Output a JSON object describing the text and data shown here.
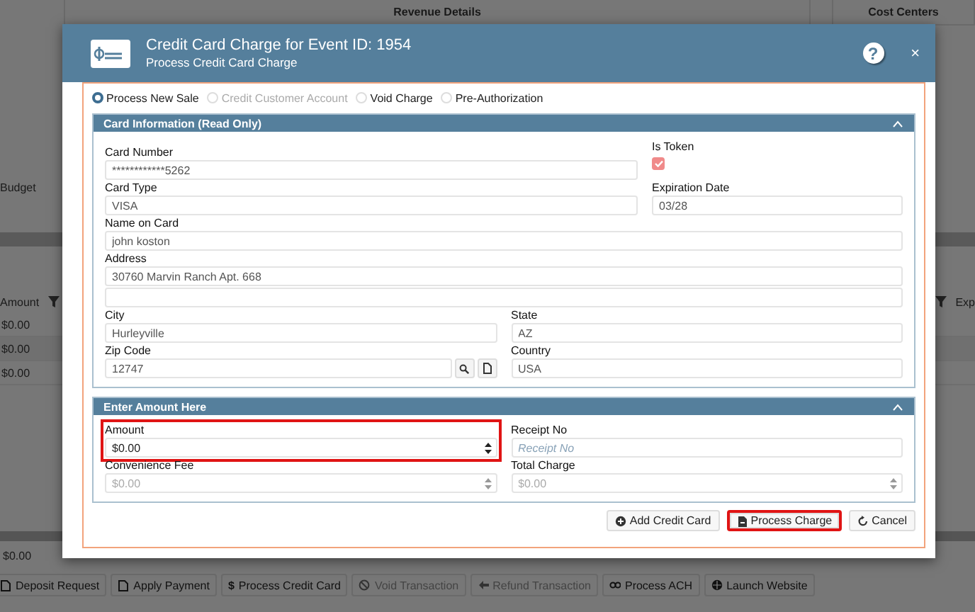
{
  "background": {
    "panels": [
      {
        "title": "Revenue Details"
      },
      {
        "title": "Cost Centers"
      }
    ],
    "budget_label": "Budget",
    "grid": {
      "column_1": "Amount",
      "column_2": "Exp",
      "rows": [
        "$0.00",
        "$0.00",
        "$0.00"
      ],
      "total": "$0.00"
    },
    "toolbar": [
      {
        "label": "Deposit Request",
        "disabled": false
      },
      {
        "label": "Apply Payment",
        "disabled": false
      },
      {
        "label": "Process Credit Card",
        "disabled": false,
        "icon_text": "$"
      },
      {
        "label": "Void Transaction",
        "disabled": true
      },
      {
        "label": "Refund Transaction",
        "disabled": true
      },
      {
        "label": "Process ACH",
        "disabled": false
      },
      {
        "label": "Launch Website",
        "disabled": false
      }
    ]
  },
  "dialog": {
    "title": "Credit Card Charge for Event ID: 1954",
    "subtitle": "Process Credit Card Charge",
    "help": "?",
    "close": "×",
    "modes": [
      {
        "label": "Process New Sale",
        "selected": true,
        "disabled": false
      },
      {
        "label": "Credit Customer Account",
        "selected": false,
        "disabled": true
      },
      {
        "label": "Void Charge",
        "selected": false,
        "disabled": false
      },
      {
        "label": "Pre-Authorization",
        "selected": false,
        "disabled": false
      }
    ],
    "card_section": {
      "title": "Card Information (Read Only)",
      "expanded": true,
      "card_number": {
        "label": "Card Number",
        "value": "************5262"
      },
      "is_token": {
        "label": "Is Token",
        "checked": true
      },
      "card_type": {
        "label": "Card Type",
        "value": "VISA"
      },
      "expiration_date": {
        "label": "Expiration Date",
        "value": "03/28"
      },
      "name_on_card": {
        "label": "Name on Card",
        "value": "john koston"
      },
      "address": {
        "label": "Address",
        "value": "30760 Marvin Ranch Apt. 668"
      },
      "city": {
        "label": "City",
        "value": "Hurleyville"
      },
      "state": {
        "label": "State",
        "value": "AZ"
      },
      "zip_code": {
        "label": "Zip Code",
        "value": "12747"
      },
      "country": {
        "label": "Country",
        "value": "USA"
      }
    },
    "amount_section": {
      "title": "Enter Amount Here",
      "expanded": true,
      "amount": {
        "label": "Amount",
        "value": "$0.00",
        "highlighted": true,
        "disabled": false
      },
      "receipt_no": {
        "label": "Receipt No",
        "placeholder": "Receipt No"
      },
      "convenience_fee": {
        "label": "Convenience Fee",
        "value": "$0.00",
        "highlighted": false,
        "disabled": true
      },
      "total_charge": {
        "label": "Total Charge",
        "value": "$0.00",
        "highlighted": false,
        "disabled": true
      }
    },
    "buttons": [
      {
        "label": "Add Credit Card",
        "highlighted": false
      },
      {
        "label": "Process Charge",
        "highlighted": true
      },
      {
        "label": "Cancel",
        "highlighted": false
      }
    ]
  }
}
